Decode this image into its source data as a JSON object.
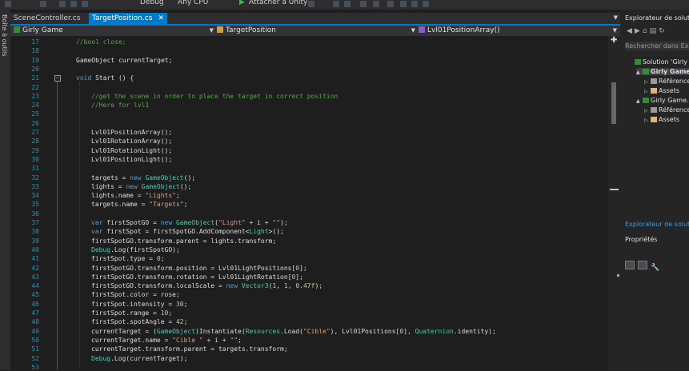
{
  "toolbar": {
    "config": "Debug",
    "platform": "Any CPU",
    "attach": "Attacher à Unity"
  },
  "left_rail": {
    "label": "Boîte à outils"
  },
  "tabs": [
    {
      "label": "SceneController.cs",
      "active": false
    },
    {
      "label": "TargetPosition.cs",
      "active": true
    }
  ],
  "nav": {
    "project": "Girly Game",
    "class": "TargetPosition",
    "member": "Lvl01PositionArray()"
  },
  "editor": {
    "lines": [
      {
        "n": "17",
        "segs": [
          [
            "cm",
            "//bool close;"
          ]
        ],
        "indent": 0
      },
      {
        "n": "18",
        "segs": [],
        "indent": 0
      },
      {
        "n": "19",
        "segs": [
          [
            "tx",
            "GameObject currentTarget;"
          ]
        ],
        "indent": 0
      },
      {
        "n": "20",
        "segs": [],
        "indent": 0
      },
      {
        "n": "21",
        "segs": [
          [
            "kw",
            "void"
          ],
          [
            "tx",
            " Start () {"
          ]
        ],
        "indent": 0
      },
      {
        "n": "22",
        "segs": [],
        "indent": 1
      },
      {
        "n": "23",
        "segs": [
          [
            "cm",
            "//get the scene in order to place the target in correct position"
          ]
        ],
        "indent": 1
      },
      {
        "n": "24",
        "segs": [
          [
            "cm",
            "//Here for lvl1"
          ]
        ],
        "indent": 1
      },
      {
        "n": "25",
        "segs": [],
        "indent": 1
      },
      {
        "n": "26",
        "segs": [],
        "indent": 1
      },
      {
        "n": "27",
        "segs": [
          [
            "tx",
            "Lvl01PositionArray();"
          ]
        ],
        "indent": 1
      },
      {
        "n": "28",
        "segs": [
          [
            "tx",
            "Lvl01RotationArray();"
          ]
        ],
        "indent": 1
      },
      {
        "n": "29",
        "segs": [
          [
            "tx",
            "Lvl01RotationLight();"
          ]
        ],
        "indent": 1
      },
      {
        "n": "30",
        "segs": [
          [
            "tx",
            "Lvl01PositionLight();"
          ]
        ],
        "indent": 1
      },
      {
        "n": "31",
        "segs": [],
        "indent": 1
      },
      {
        "n": "32",
        "segs": [
          [
            "tx",
            "targets = "
          ],
          [
            "kw",
            "new"
          ],
          [
            "tx",
            " "
          ],
          [
            "ty",
            "GameObject"
          ],
          [
            "tx",
            "();"
          ]
        ],
        "indent": 1
      },
      {
        "n": "33",
        "segs": [
          [
            "tx",
            "lights = "
          ],
          [
            "kw",
            "new"
          ],
          [
            "tx",
            " "
          ],
          [
            "ty",
            "GameObject"
          ],
          [
            "tx",
            "();"
          ]
        ],
        "indent": 1
      },
      {
        "n": "34",
        "segs": [
          [
            "tx",
            "lights.name = "
          ],
          [
            "st",
            "\"Lights\""
          ],
          [
            "tx",
            ";"
          ]
        ],
        "indent": 1
      },
      {
        "n": "35",
        "segs": [
          [
            "tx",
            "targets.name = "
          ],
          [
            "st",
            "\"Targets\""
          ],
          [
            "tx",
            ";"
          ]
        ],
        "indent": 1
      },
      {
        "n": "36",
        "segs": [],
        "indent": 1
      },
      {
        "n": "37",
        "segs": [
          [
            "kw",
            "var"
          ],
          [
            "tx",
            " firstSpotGO = "
          ],
          [
            "kw",
            "new"
          ],
          [
            "tx",
            " "
          ],
          [
            "ty",
            "GameObject"
          ],
          [
            "tx",
            "("
          ],
          [
            "st",
            "\"Light\""
          ],
          [
            "tx",
            " + i + "
          ],
          [
            "st",
            "\"\""
          ],
          [
            "tx",
            ");"
          ]
        ],
        "indent": 1
      },
      {
        "n": "38",
        "segs": [
          [
            "kw",
            "var"
          ],
          [
            "tx",
            " firstSpot = firstSpotGO.AddComponent<"
          ],
          [
            "ty",
            "Light"
          ],
          [
            "tx",
            ">();"
          ]
        ],
        "indent": 1
      },
      {
        "n": "39",
        "segs": [
          [
            "tx",
            "firstSpotGO.transform.parent = lights.transform;"
          ]
        ],
        "indent": 1
      },
      {
        "n": "40",
        "segs": [
          [
            "ty",
            "Debug"
          ],
          [
            "tx",
            ".Log(firstSpotGO);"
          ]
        ],
        "indent": 1
      },
      {
        "n": "41",
        "segs": [
          [
            "tx",
            "firstSpot.type = "
          ],
          [
            "nm",
            "0"
          ],
          [
            "tx",
            ";"
          ]
        ],
        "indent": 1
      },
      {
        "n": "42",
        "segs": [
          [
            "tx",
            "firstSpotGO.transform.position = Lvl01LightPositions["
          ],
          [
            "nm",
            "0"
          ],
          [
            "tx",
            "];"
          ]
        ],
        "indent": 1
      },
      {
        "n": "43",
        "segs": [
          [
            "tx",
            "firstSpotGO.transform.rotation = Lvl01LightRotation["
          ],
          [
            "nm",
            "0"
          ],
          [
            "tx",
            "];"
          ]
        ],
        "indent": 1
      },
      {
        "n": "44",
        "segs": [
          [
            "tx",
            "firstSpotGO.transform.localScale = "
          ],
          [
            "kw",
            "new"
          ],
          [
            "tx",
            " "
          ],
          [
            "ty",
            "Vector3"
          ],
          [
            "tx",
            "("
          ],
          [
            "nm",
            "1"
          ],
          [
            "tx",
            ", "
          ],
          [
            "nm",
            "1"
          ],
          [
            "tx",
            ", "
          ],
          [
            "nm",
            "0.47f"
          ],
          [
            "tx",
            ");"
          ]
        ],
        "indent": 1
      },
      {
        "n": "45",
        "segs": [
          [
            "tx",
            "firstSpot.color = rose;"
          ]
        ],
        "indent": 1
      },
      {
        "n": "46",
        "segs": [
          [
            "tx",
            "firstSpot.intensity = "
          ],
          [
            "nm",
            "30"
          ],
          [
            "tx",
            ";"
          ]
        ],
        "indent": 1
      },
      {
        "n": "47",
        "segs": [
          [
            "tx",
            "firstSpot.range = "
          ],
          [
            "nm",
            "10"
          ],
          [
            "tx",
            ";"
          ]
        ],
        "indent": 1
      },
      {
        "n": "48",
        "segs": [
          [
            "tx",
            "firstSpot.spotAngle = "
          ],
          [
            "nm",
            "42"
          ],
          [
            "tx",
            ";"
          ]
        ],
        "indent": 1
      },
      {
        "n": "49",
        "segs": [
          [
            "tx",
            "currentTarget = ("
          ],
          [
            "ty",
            "GameObject"
          ],
          [
            "tx",
            ")Instantiate("
          ],
          [
            "ty",
            "Resources"
          ],
          [
            "tx",
            ".Load("
          ],
          [
            "st",
            "\"Cible\""
          ],
          [
            "tx",
            "), Lvl01Positions["
          ],
          [
            "nm",
            "0"
          ],
          [
            "tx",
            "], "
          ],
          [
            "ty",
            "Quaternion"
          ],
          [
            "tx",
            ".identity);"
          ]
        ],
        "indent": 1
      },
      {
        "n": "50",
        "segs": [
          [
            "tx",
            "currentTarget.name = "
          ],
          [
            "st",
            "\"Cible \""
          ],
          [
            "tx",
            " + i + "
          ],
          [
            "st",
            "\"\""
          ],
          [
            "tx",
            ";"
          ]
        ],
        "indent": 1
      },
      {
        "n": "51",
        "segs": [
          [
            "tx",
            "currentTarget.transform.parent = targets.transform;"
          ]
        ],
        "indent": 1
      },
      {
        "n": "52",
        "segs": [
          [
            "ty",
            "Debug"
          ],
          [
            "tx",
            ".Log(currentTarget);"
          ]
        ],
        "indent": 1
      },
      {
        "n": "53",
        "segs": [],
        "indent": 1
      }
    ]
  },
  "solution_explorer": {
    "title": "Explorateur de solutions",
    "search_placeholder": "Rechercher dans Explorateur de solutions",
    "tree": [
      {
        "label": "Solution 'Girly Game'",
        "level": 0,
        "toggle": "",
        "bold": false
      },
      {
        "label": "Girly Game",
        "level": 1,
        "toggle": "▲",
        "bold": true
      },
      {
        "label": "Références",
        "level": 2,
        "toggle": "▷",
        "bold": false
      },
      {
        "label": "Assets",
        "level": 2,
        "toggle": "▷",
        "bold": false
      },
      {
        "label": "Girly Game.Editor",
        "level": 1,
        "toggle": "▲",
        "bold": false
      },
      {
        "label": "Références",
        "level": 2,
        "toggle": "▷",
        "bold": false
      },
      {
        "label": "Assets",
        "level": 2,
        "toggle": "▷",
        "bold": false
      }
    ],
    "tab_link": "Explorateur de solutions"
  },
  "properties": {
    "title": "Propriétés"
  },
  "colors": {
    "accent": "#007acc",
    "keyword": "#569cd6",
    "type": "#4ec9b0",
    "string": "#d69d85",
    "comment": "#57a64a"
  }
}
